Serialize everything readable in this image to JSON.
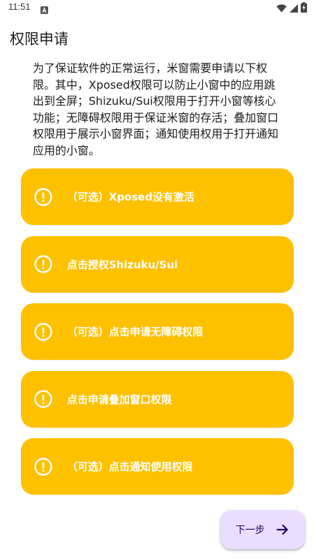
{
  "status_bar": {
    "time": "11:51",
    "notification_icon": "a-badge-icon",
    "wifi_icon": "wifi-icon",
    "signal_icon": "cell-signal-icon",
    "battery_icon": "battery-charging-icon"
  },
  "page": {
    "title": "权限申请",
    "description": "为了保证软件的正常运行，米窗需要申请以下权限。其中，Xposed权限可以防止小窗中的应用跳出到全屏；Shizuku/Sui权限用于打开小窗等核心功能；无障碍权限用于保证米窗的存活；叠加窗口权限用于展示小窗界面；通知使用权用于打开通知应用的小窗。"
  },
  "permissions": [
    {
      "label": "（可选）Xposed没有激活",
      "icon": "alert-circle-icon"
    },
    {
      "label": "点击授权Shizuku/Sui",
      "icon": "alert-circle-icon"
    },
    {
      "label": "（可选）点击申请无障碍权限",
      "icon": "alert-circle-icon"
    },
    {
      "label": "点击申请叠加窗口权限",
      "icon": "alert-circle-icon"
    },
    {
      "label": "（可选）点击通知使用权限",
      "icon": "alert-circle-icon"
    }
  ],
  "next_button": {
    "label": "下一步",
    "icon": "arrow-right-icon"
  },
  "colors": {
    "card_background": "#fec100",
    "card_text": "#ffffff",
    "fab_background": "#eaddff",
    "fab_text": "#21005d"
  }
}
